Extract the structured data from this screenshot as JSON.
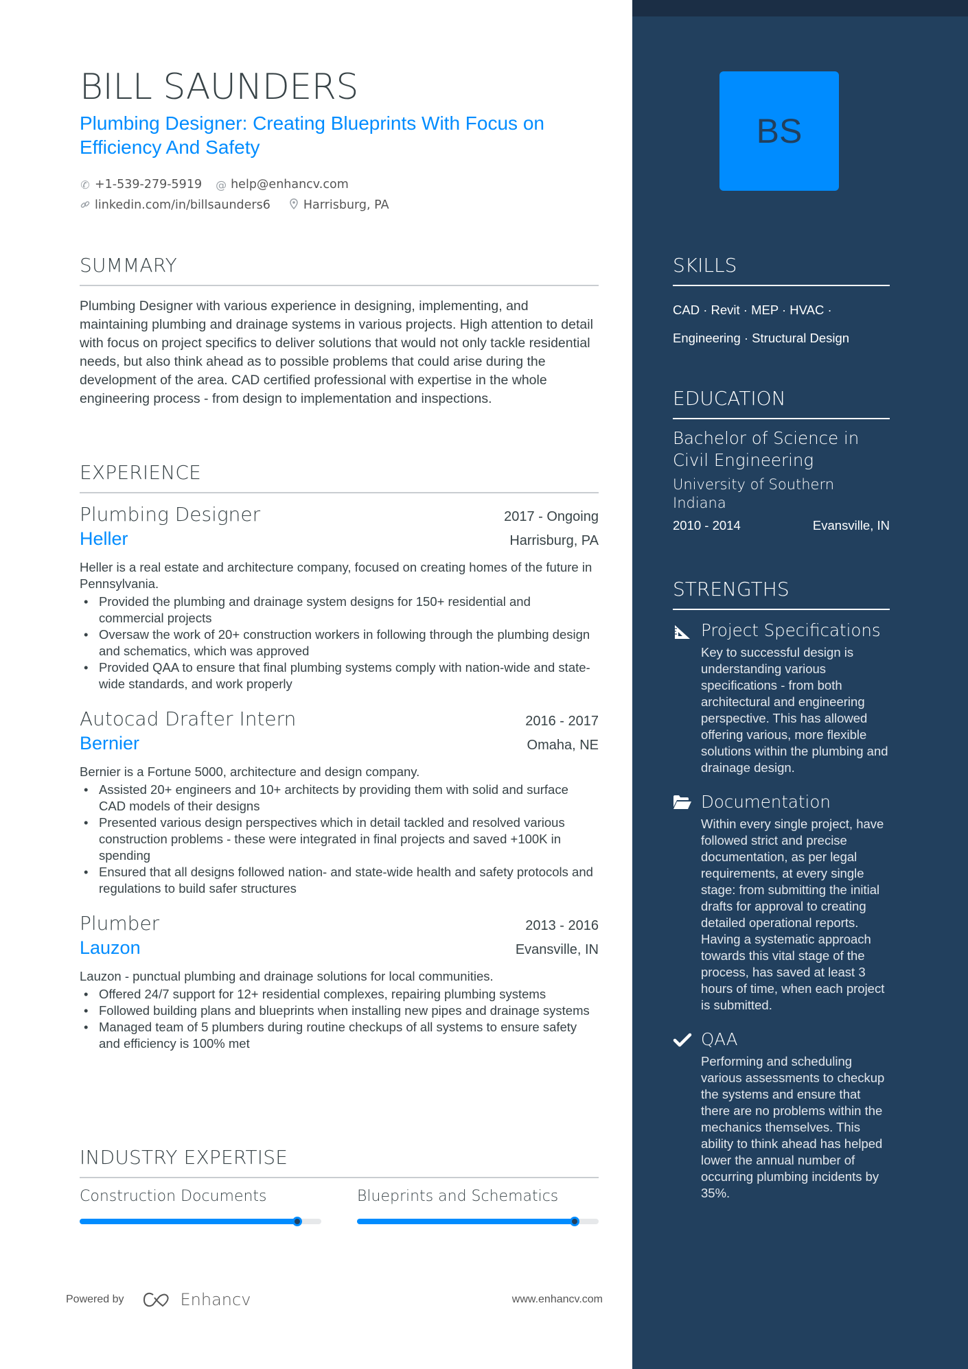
{
  "header": {
    "name": "BILL SAUNDERS",
    "tagline": "Plumbing Designer: Creating Blueprints With Focus on Efficiency And Safety",
    "contacts": {
      "phone": {
        "icon": "phone-icon",
        "text": "+1-539-279-5919"
      },
      "email": {
        "icon": "at-icon",
        "text": "help@enhancv.com"
      },
      "linkedin": {
        "icon": "link-icon",
        "text": "linkedin.com/in/billsaunders6"
      },
      "location": {
        "icon": "map-pin-icon",
        "text": "Harrisburg, PA"
      }
    }
  },
  "summary": {
    "title": "SUMMARY",
    "text": "Plumbing Designer with various experience in designing, implementing, and maintaining plumbing and drainage systems in various projects. High attention to detail with focus on project specifics to deliver solutions that would not only tackle residential needs, but also think ahead as to possible problems that could arise during the development of the area. CAD certified professional with expertise in the whole engineering process - from design to implementation and inspections."
  },
  "experience": {
    "title": "EXPERIENCE",
    "jobs": [
      {
        "title": "Plumbing Designer",
        "dates": "2017 - Ongoing",
        "company": "Heller",
        "location": "Harrisburg, PA",
        "description": "Heller is a real estate and architecture company, focused on creating homes of the future in Pennsylvania.",
        "bullets": [
          "Provided the plumbing and drainage system designs for 150+ residential and commercial projects",
          "Oversaw the work of 20+ construction workers in following through the plumbing design and schematics, which was approved",
          "Provided QAA to ensure that final plumbing systems comply with nation-wide and state-wide standards, and work properly"
        ]
      },
      {
        "title": "Autocad Drafter Intern",
        "dates": "2016 - 2017",
        "company": "Bernier",
        "location": "Omaha, NE",
        "description": "Bernier is a Fortune 5000, architecture and design company.",
        "bullets": [
          "Assisted 20+ engineers and 10+ architects by providing them with solid and surface CAD models of their designs",
          "Presented various design perspectives which in detail tackled and resolved various construction problems - these were integrated in final projects and saved +100K in spending",
          "Ensured that all designs followed nation- and state-wide health and safety protocols and regulations to build safer structures"
        ]
      },
      {
        "title": "Plumber",
        "dates": "2013 - 2016",
        "company": "Lauzon",
        "location": "Evansville, IN",
        "description": "Lauzon - punctual plumbing and drainage solutions for local communities.",
        "bullets": [
          "Offered 24/7 support for 12+ residential complexes, repairing plumbing systems",
          "Followed building plans and blueprints when installing new pipes and drainage systems",
          "Managed team of 5 plumbers during routine checkups of all systems to ensure safety and efficiency is 100% met"
        ]
      }
    ]
  },
  "industry_expertise": {
    "title": "INDUSTRY EXPERTISE",
    "items": [
      {
        "label": "Construction Documents",
        "level_percent": 90
      },
      {
        "label": "Blueprints and Schematics",
        "level_percent": 90
      }
    ]
  },
  "footer": {
    "powered_by": "Powered by",
    "brand": "Enhancv",
    "website": "www.enhancv.com"
  },
  "sidebar": {
    "avatar_initials": "BS",
    "skills": {
      "title": "SKILLS",
      "line1": "CAD · Revit · MEP · HVAC ·",
      "line2": "Engineering · Structural Design"
    },
    "education": {
      "title": "EDUCATION",
      "degree": "Bachelor of Science in Civil Engineering",
      "school": "University of Southern Indiana",
      "dates": "2010 - 2014",
      "location": "Evansville, IN"
    },
    "strengths": {
      "title": "STRENGTHS",
      "items": [
        {
          "icon": "set-square-icon",
          "title": "Project Specifications",
          "description": "Key to successful design is understanding various specifications - from both architectural and engineering perspective. This has allowed offering various, more flexible solutions within the plumbing and drainage design."
        },
        {
          "icon": "folder-open-icon",
          "title": "Documentation",
          "description": "Within every single project, have followed strict and precise documentation, as per legal requirements, at every single stage: from submitting the initial drafts for approval to creating detailed operational reports. Having a systematic approach towards this vital stage of the process, has saved at least 3 hours of time, when each project is submitted."
        },
        {
          "icon": "checkmark-icon",
          "title": "QAA",
          "description": "Performing and scheduling various assessments to checkup the systems and ensure that there are no problems within the mechanics themselves. This ability to think ahead has helped lower the annual number of occurring plumbing incidents by 35%."
        }
      ]
    }
  },
  "colors": {
    "accent": "#008cff",
    "sidebar_bg": "#22405e",
    "sidebar_top": "#1b2e45",
    "text": "#384347"
  }
}
